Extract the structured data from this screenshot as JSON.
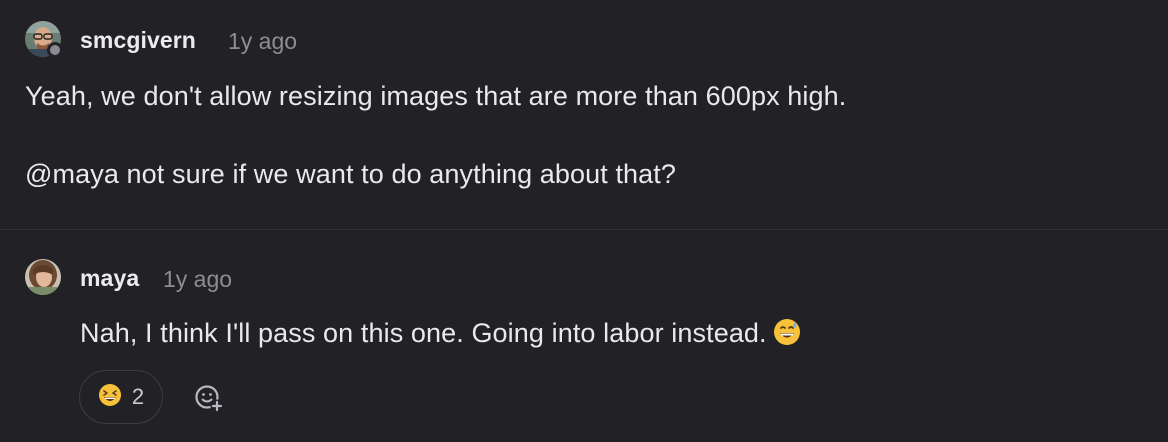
{
  "comments": [
    {
      "author": "smcgivern",
      "time": "1y ago",
      "line1": "Yeah, we don't allow resizing images that are more than 600px high.",
      "mention": "@maya",
      "line2_rest": " not sure if we want to do anything about that?",
      "avatar_icon": "user-avatar-glasses-icon",
      "status": "offline"
    },
    {
      "author": "maya",
      "time": "1y ago",
      "text": "Nah, I think I'll pass on this one. Going into labor instead.",
      "inline_emoji": "grinning-face-with-sweat-emoji",
      "avatar_icon": "user-avatar-icon",
      "reactions": [
        {
          "emoji": "laughing-face-emoji",
          "count": "2"
        }
      ],
      "add_reaction_icon": "add-reaction-icon"
    }
  ],
  "colors": {
    "background": "#222226",
    "divider": "#313136",
    "text": "#e9e9ed",
    "muted": "#8d8d94",
    "emoji_yellow": "#f7c23a"
  }
}
